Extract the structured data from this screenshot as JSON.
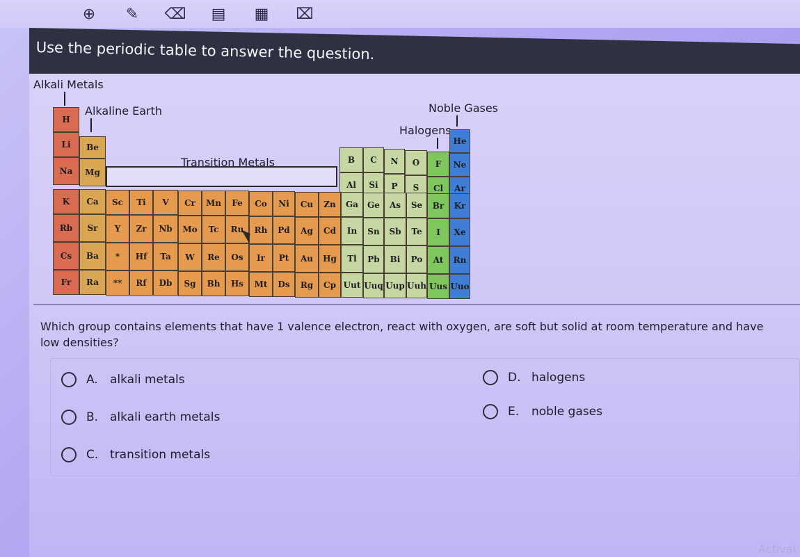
{
  "toolbar": {
    "tools": [
      {
        "icon": "zoom-in-icon"
      },
      {
        "icon": "pencil-icon"
      },
      {
        "icon": "eraser-icon"
      },
      {
        "icon": "calculator-icon"
      },
      {
        "icon": "notepad-icon"
      },
      {
        "icon": "flag-icon"
      }
    ]
  },
  "header": {
    "title": "Use the periodic table to answer the question."
  },
  "table_labels": {
    "alkali": "Alkali Metals",
    "alkaline": "Alkaline Earth",
    "transition": "Transition Metals",
    "halogens": "Halogens",
    "noble": "Noble Gases"
  },
  "elements": {
    "row1": [
      "H",
      "He"
    ],
    "row2": [
      "Li",
      "Be",
      "B",
      "C",
      "N",
      "O",
      "F",
      "Ne"
    ],
    "row3": [
      "Na",
      "Mg",
      "Al",
      "Si",
      "P",
      "S",
      "Cl",
      "Ar"
    ],
    "row4": [
      "K",
      "Ca",
      "Sc",
      "Ti",
      "V",
      "Cr",
      "Mn",
      "Fe",
      "Co",
      "Ni",
      "Cu",
      "Zn",
      "Ga",
      "Ge",
      "As",
      "Se",
      "Br",
      "Kr"
    ],
    "row5": [
      "Rb",
      "Sr",
      "Y",
      "Zr",
      "Nb",
      "Mo",
      "Tc",
      "Ru",
      "Rh",
      "Pd",
      "Ag",
      "Cd",
      "In",
      "Sn",
      "Sb",
      "Te",
      "I",
      "Xe"
    ],
    "row6": [
      "Cs",
      "Ba",
      "*",
      "Hf",
      "Ta",
      "W",
      "Re",
      "Os",
      "Ir",
      "Pt",
      "Au",
      "Hg",
      "Tl",
      "Pb",
      "Bi",
      "Po",
      "At",
      "Rn"
    ],
    "row7": [
      "Fr",
      "Ra",
      "**",
      "Rf",
      "Db",
      "Sg",
      "Bh",
      "Hs",
      "Mt",
      "Ds",
      "Rg",
      "Cp",
      "Uut",
      "Uuq",
      "Uup",
      "Uuh",
      "Uus",
      "Uuo"
    ]
  },
  "question": {
    "text": "Which group contains elements that have 1 valence electron, react with oxygen, are soft but solid at room temperature and have low densities?"
  },
  "answers": [
    {
      "letter": "A.",
      "label": "alkali metals"
    },
    {
      "letter": "B.",
      "label": "alkali earth metals"
    },
    {
      "letter": "C.",
      "label": "transition metals"
    },
    {
      "letter": "D.",
      "label": "halogens"
    },
    {
      "letter": "E.",
      "label": "noble gases"
    }
  ],
  "watermark": "Activat"
}
